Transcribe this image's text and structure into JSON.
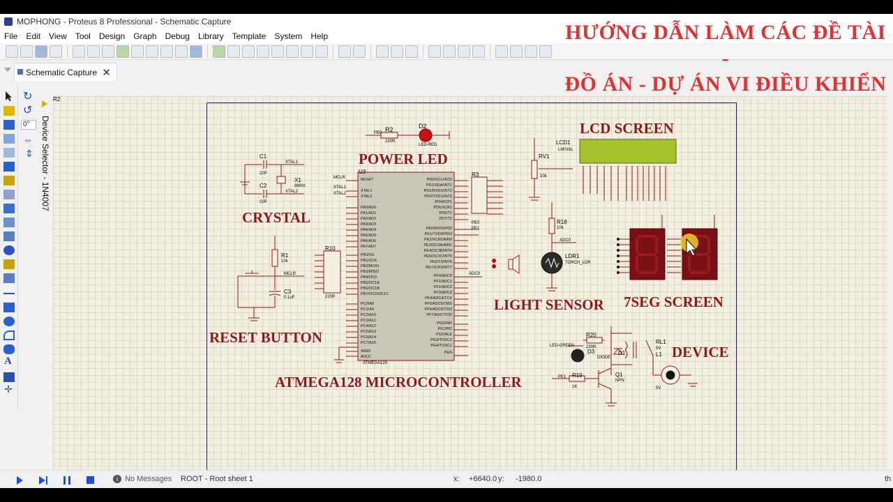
{
  "window": {
    "title": "MOPHONG - Proteus 8 Professional - Schematic Capture"
  },
  "menu": [
    "File",
    "Edit",
    "View",
    "Tool",
    "Design",
    "Graph",
    "Debug",
    "Library",
    "Template",
    "System",
    "Help"
  ],
  "tab": {
    "label": "Schematic Capture",
    "close": "✕"
  },
  "watermark": {
    "line1": "HƯỚNG DẪN LÀM CÁC ĐỀ TÀI -",
    "line2": "ĐỒ ÁN - DỰ ÁN VI ĐIỀU KHIỂN"
  },
  "left_panel": {
    "rotation": "0°",
    "device_selector": "Device Selector - 1N4007"
  },
  "schematic": {
    "labels": {
      "power_led": "POWER LED",
      "crystal": "CRYSTAL",
      "reset_button": "RESET BUTTON",
      "mcu": "ATMEGA128 MICROCONTROLLER",
      "lcd": "LCD SCREEN",
      "light_sensor": "LIGHT SENSOR",
      "seven_seg": "7SEG SCREEN",
      "device": "DEVICE"
    },
    "parts": {
      "r2": "R2",
      "r2_val": "220R",
      "d2": "D2",
      "d2_type": "LED-RED",
      "pe0": "PE0",
      "c1": "C1",
      "c2": "C2",
      "c1_val": "22P",
      "x1": "X1",
      "x1_val": "8MHz",
      "xtal1": "XTAL1",
      "xtal2": "XTAL2",
      "r1": "R1",
      "r1_val": "10k",
      "c3": "C3",
      "c3_val": "0.1uF",
      "mclr": "MCLR",
      "u3": "U3",
      "u3_part": "ATMEGA128",
      "r3": "R3",
      "r10": "R10",
      "r10_val": "220R",
      "lcd1": "LCD1",
      "lcd1_part": "LM016L",
      "rv1": "RV1",
      "rv1_val": "10k",
      "r18": "R18",
      "r18_val": "10k",
      "ldr1": "LDR1",
      "ldr1_part": "TORCH_LDR",
      "adc0": "ADC0",
      "r20": "R20",
      "r20_val": "220R",
      "d3": "D3",
      "d3_type": "LED-GREEN",
      "d1": "D1",
      "d1_type": "DIODE",
      "rl1": "RL1",
      "rl1_val": "5V",
      "l1": "L1",
      "l1_val": "5V",
      "r19": "R19",
      "r19_val": "1K",
      "q1": "Q1",
      "q1_type": "NPN",
      "pe1": "PE1",
      "fan_v": "5V",
      "mcu_left_pins": [
        "RESET",
        "XTAL1",
        "XTAL2",
        "PA0/AD0",
        "PA1/AD1",
        "PA2/AD2",
        "PA3/AD3",
        "PA4/AD4",
        "PA5/AD5",
        "PA6/AD6",
        "PA7/AD7",
        "PB0/SS",
        "PB1/SCK",
        "PB2/MOSI",
        "PB3/MISO",
        "PB4/OC0",
        "PB5/OC1A",
        "PB6/OC1B",
        "PB7/OC2/OC1C",
        "PC0/A8",
        "PC1/A9",
        "PC2/A10",
        "PC3/A11",
        "PC4/A12",
        "PC5/A13",
        "PC6/A14",
        "PC7/A15",
        "AREF",
        "AVCC"
      ],
      "mcu_right_pins": [
        "PD0/SCL/INT0",
        "PD1/SDA/INT1",
        "PD2/RXD1/INT2",
        "PD3/TXD1/INT3",
        "PD4/ICP1",
        "PD5/XCK1",
        "PD6/T1",
        "PD7/T2",
        "PE0/RXD0/PDI",
        "PE1/TXD0/PDO",
        "PE2/XCK0/AIN0",
        "PE3/OC3A/AIN1",
        "PE4/OC3B/INT4",
        "PE5/OC3C/INT5",
        "PE6/T3/INT6",
        "PE7/ICP3/INT7",
        "PF0/ADC0",
        "PF1/ADC1",
        "PF2/ADC2",
        "PF3/ADC3",
        "PF4/ADC4/TCK",
        "PF5/ADC5/TMS",
        "PF6/ADC6/TDO",
        "PF7/ADC7/TDI",
        "PG0/WR",
        "PG1/RD",
        "PG2/ALE",
        "PG3/TOSC2",
        "PG4/TOSC1",
        "PEN"
      ]
    }
  },
  "status": {
    "messages": "No Messages",
    "sheet": "ROOT - Root sheet 1",
    "x_label": "x:",
    "x_value": "+6640.0",
    "y_label": "y:",
    "y_value": "-1980.0",
    "th": "th"
  }
}
